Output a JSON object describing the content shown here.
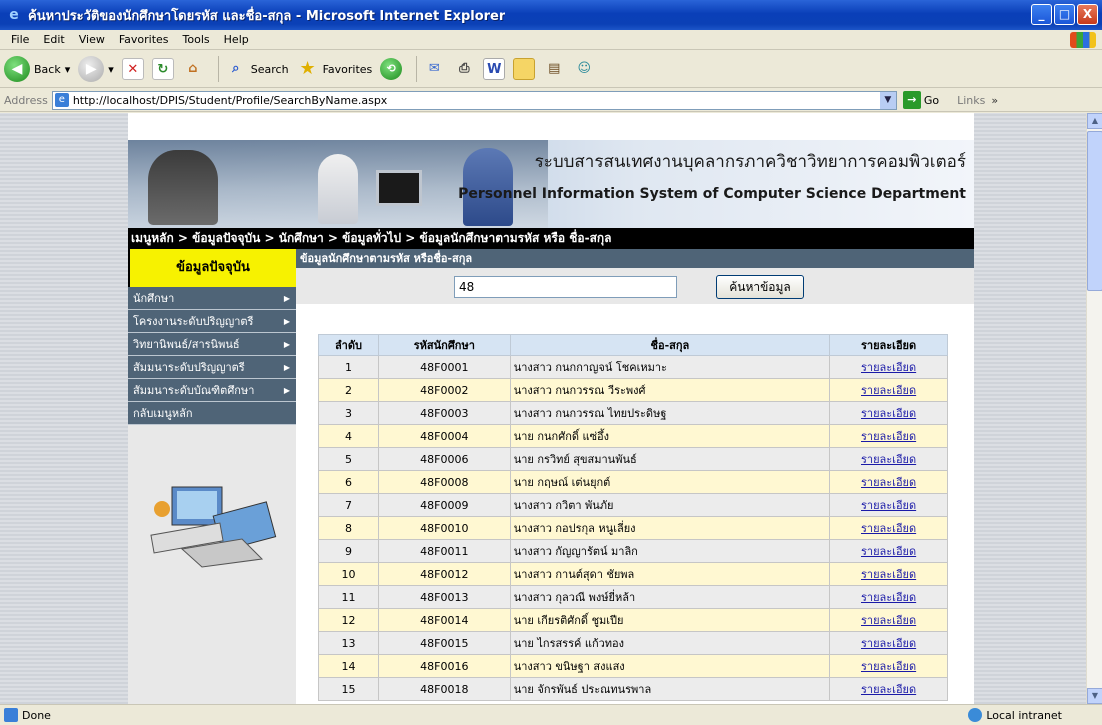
{
  "window": {
    "title": "ค้นหาประวัติของนักศึกษาโดยรหัส และชื่อ-สกุล - Microsoft Internet Explorer",
    "min_label": "_",
    "max_label": "□",
    "close_label": "X"
  },
  "menu": [
    "File",
    "Edit",
    "View",
    "Favorites",
    "Tools",
    "Help"
  ],
  "toolbar": {
    "back": "Back",
    "search": "Search",
    "favorites": "Favorites"
  },
  "address": {
    "label": "Address",
    "url": "http://localhost/DPIS/Student/Profile/SearchByName.aspx",
    "go": "Go",
    "links": "Links"
  },
  "banner": {
    "title_th": "ระบบสารสนเทศงานบุคลากรภาควิชาวิทยาการคอมพิวเตอร์",
    "title_en": "Personnel Information System of Computer Science Department"
  },
  "breadcrumb": "เมนูหลัก > ข้อมูลปัจจุบัน > นักศึกษา > ข้อมูลทั่วไป > ข้อมูลนักศึกษาตามรหัส หรือ ชื่อ-สกุล",
  "sidebar": {
    "header": "ข้อมูลปัจจุบัน",
    "items": [
      {
        "label": "นักศึกษา",
        "arrow": "▶"
      },
      {
        "label": "โครงงานระดับปริญญาตรี",
        "arrow": "▶"
      },
      {
        "label": "วิทยานิพนธ์/สารนิพนธ์",
        "arrow": "▶"
      },
      {
        "label": "สัมมนาระดับปริญญาตรี",
        "arrow": "▶"
      },
      {
        "label": "สัมมนาระดับบัณฑิตศึกษา",
        "arrow": "▶"
      },
      {
        "label": "กลับเมนูหลัก",
        "arrow": ""
      }
    ]
  },
  "main": {
    "header": "ข้อมูลนักศึกษาตามรหัส หรือชื่อ-สกุล",
    "search_value": "48",
    "search_button": "ค้นหาข้อมูล"
  },
  "table": {
    "headers": [
      "ลำดับ",
      "รหัสนักศึกษา",
      "ชื่อ-สกุล",
      "รายละเอียด"
    ],
    "rows": [
      [
        "1",
        "48F0001",
        "นางสาว กนกกาญจน์ โชคเหมาะ",
        "รายละเอียด"
      ],
      [
        "2",
        "48F0002",
        "นางสาว กนกวรรณ วีระพงศ์",
        "รายละเอียด"
      ],
      [
        "3",
        "48F0003",
        "นางสาว กนกวรรณ ไทยประดิษฐ",
        "รายละเอียด"
      ],
      [
        "4",
        "48F0004",
        "นาย กนกศักดิ์ แซ่อึ้ง",
        "รายละเอียด"
      ],
      [
        "5",
        "48F0006",
        "นาย กรวิทย์ สุขสมานพันธ์",
        "รายละเอียด"
      ],
      [
        "6",
        "48F0008",
        "นาย กฤษณ์ เต่นยุกต์",
        "รายละเอียด"
      ],
      [
        "7",
        "48F0009",
        "นางสาว กวิตา พันภัย",
        "รายละเอียด"
      ],
      [
        "8",
        "48F0010",
        "นางสาว กอปรกุล หนูเลี่ยง",
        "รายละเอียด"
      ],
      [
        "9",
        "48F0011",
        "นางสาว กัญญารัตน์ มาลิก",
        "รายละเอียด"
      ],
      [
        "10",
        "48F0012",
        "นางสาว กานต์สุดา ชัยพล",
        "รายละเอียด"
      ],
      [
        "11",
        "48F0013",
        "นางสาว กุลวณี พงษ์ยี่หล้า",
        "รายละเอียด"
      ],
      [
        "12",
        "48F0014",
        "นาย เกียรติศักดิ์ ชูมเปีย",
        "รายละเอียด"
      ],
      [
        "13",
        "48F0015",
        "นาย ไกรสรรค์ แก้วทอง",
        "รายละเอียด"
      ],
      [
        "14",
        "48F0016",
        "นางสาว ขนิษฐา สงแสง",
        "รายละเอียด"
      ],
      [
        "15",
        "48F0018",
        "นาย จักรพันธ์ ประณทนรพาล",
        "รายละเอียด"
      ]
    ]
  },
  "status": {
    "text": "Done",
    "zone": "Local intranet"
  },
  "colors": {
    "titlebar": "#0a3fb8",
    "nav": "#4f6477",
    "sidebar_header": "#f7f200",
    "row_odd": "#ececec",
    "row_even": "#fff8d2",
    "table_header": "#d6e4f3"
  }
}
